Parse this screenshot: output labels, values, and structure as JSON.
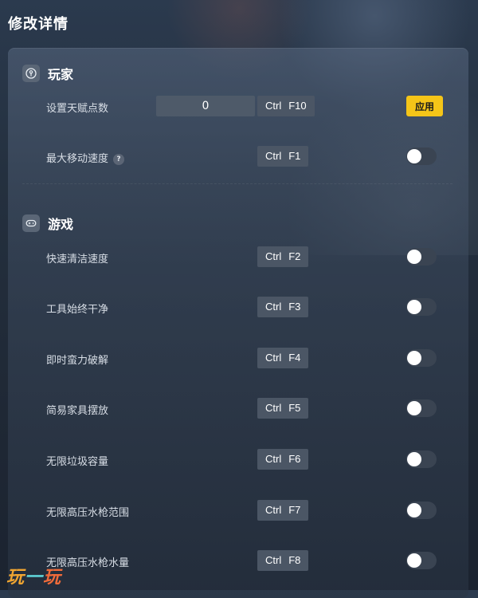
{
  "header": {
    "title": "修改详情"
  },
  "sections": {
    "player": {
      "title": "玩家",
      "icon": "player-icon",
      "rows": [
        {
          "label": "设置天赋点数",
          "value": "0",
          "hotkey": [
            "Ctrl",
            "F10"
          ],
          "action": "应用"
        },
        {
          "label": "最大移动速度",
          "help": "?",
          "hotkey": [
            "Ctrl",
            "F1"
          ],
          "enabled": false
        }
      ]
    },
    "game": {
      "title": "游戏",
      "icon": "gamepad-icon",
      "rows": [
        {
          "label": "快速清洁速度",
          "hotkey": [
            "Ctrl",
            "F2"
          ],
          "enabled": false
        },
        {
          "label": "工具始终干净",
          "hotkey": [
            "Ctrl",
            "F3"
          ],
          "enabled": false
        },
        {
          "label": "即时蛮力破解",
          "hotkey": [
            "Ctrl",
            "F4"
          ],
          "enabled": false
        },
        {
          "label": "简易家具摆放",
          "hotkey": [
            "Ctrl",
            "F5"
          ],
          "enabled": false
        },
        {
          "label": "无限垃圾容量",
          "hotkey": [
            "Ctrl",
            "F6"
          ],
          "enabled": false
        },
        {
          "label": "无限高压水枪范围",
          "hotkey": [
            "Ctrl",
            "F7"
          ],
          "enabled": false
        },
        {
          "label": "无限高压水枪水量",
          "hotkey": [
            "Ctrl",
            "F8"
          ],
          "enabled": false
        }
      ]
    }
  },
  "watermark": {
    "part1": "玩",
    "part2": "一",
    "part3": "玩"
  },
  "colors": {
    "accent": "#f5c518",
    "panel": "#3c4a5e",
    "toggle_off": "#3a4452"
  }
}
